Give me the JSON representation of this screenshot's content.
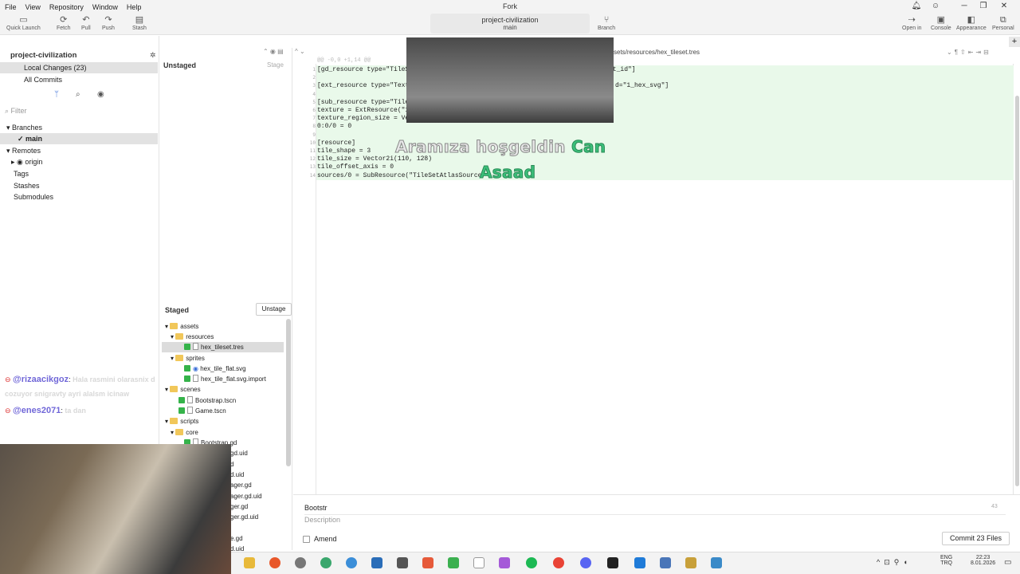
{
  "menu": {
    "items": [
      "File",
      "View",
      "Repository",
      "Window",
      "Help"
    ],
    "title": "Fork"
  },
  "toolbar": {
    "quick_launch": "Quick Launch",
    "fetch": "Fetch",
    "pull": "Pull",
    "push": "Push",
    "stash": "Stash",
    "repo_name": "project-civilization",
    "branch_name": "main",
    "branch": "Branch",
    "open_in": "Open in",
    "console": "Console",
    "appearance": "Appearance",
    "personal": "Personal"
  },
  "sidebar": {
    "repo": "project-civilization",
    "local_changes": "Local Changes (23)",
    "all_commits": "All Commits",
    "filter_placeholder": "Filter",
    "branches": "Branches",
    "main": "main",
    "remotes": "Remotes",
    "origin": "origin",
    "tags": "Tags",
    "stashes": "Stashes",
    "submodules": "Submodules"
  },
  "unstaged": {
    "title": "Unstaged",
    "stage_button": "Stage"
  },
  "staged": {
    "title": "Staged",
    "unstage_button": "Unstage",
    "tree": [
      "assets",
      "resources",
      "hex_tileset.tres",
      "sprites",
      "hex_tile_flat.svg",
      "hex_tile_flat.svg.import",
      "scenes",
      "Bootstrap.tscn",
      "Game.tscn",
      "scripts",
      "core",
      "Bootstrap.gd",
      "gd.uid",
      "d",
      "d.uid",
      "ager.gd",
      "ager.gd.uid",
      "ger.gd",
      "ger.gd.uid",
      "e.gd",
      "d.uid"
    ]
  },
  "diff": {
    "path_suffix": "sets/resources/",
    "file": "hex_tileset.tres",
    "hunk": "@@ -0,0 +1,14 @@",
    "lines": [
      {
        "n": "1",
        "t": "[gd_resource type=\"TileS"
      },
      {
        "n": "2",
        "t": ""
      },
      {
        "n": "3",
        "t": "[ext_resource type=\"Text"
      },
      {
        "n": "4",
        "t": ""
      },
      {
        "n": "5",
        "t": "[sub_resource type=\"Tile"
      },
      {
        "n": "6",
        "t": "texture = ExtResource(\"1"
      },
      {
        "n": "7",
        "t": "texture_region_size = Ve"
      },
      {
        "n": "8",
        "t": "0:0/0 = 0"
      },
      {
        "n": "9",
        "t": ""
      },
      {
        "n": "10",
        "t": "[resource]"
      },
      {
        "n": "11",
        "t": "tile_shape = 3"
      },
      {
        "n": "12",
        "t": "tile_size = Vector2i(110, 128)"
      },
      {
        "n": "13",
        "t": "tile_offset_axis = 0"
      },
      {
        "n": "14",
        "t": "sources/0 = SubResource(\"TileSetAtlasSource"
      }
    ],
    "tail1": "et_id\"]",
    "tail3": "d=\"1_hex_svg\"]"
  },
  "commit": {
    "subject_value": "Bootstr",
    "char_count": "43",
    "description_placeholder": "Description",
    "amend": "Amend",
    "commit_button": "Commit 23 Files"
  },
  "overlay": {
    "welcome_white": "Aramıza hoşgeldin",
    "welcome_green1": "Can",
    "welcome_green2": "Asaad",
    "chat": [
      {
        "user": "@rizaacikgoz",
        "msg": "Hala rasmini olarasnix d"
      },
      {
        "user": "",
        "msg": "cozuyor snigravty ayri alalsm icinaw"
      },
      {
        "user": "@enes2071",
        "msg": "ta dan"
      }
    ]
  },
  "tray": {
    "lang1": "ENG",
    "lang2": "TRQ",
    "time": "22:23",
    "date": "8.01.2026"
  }
}
